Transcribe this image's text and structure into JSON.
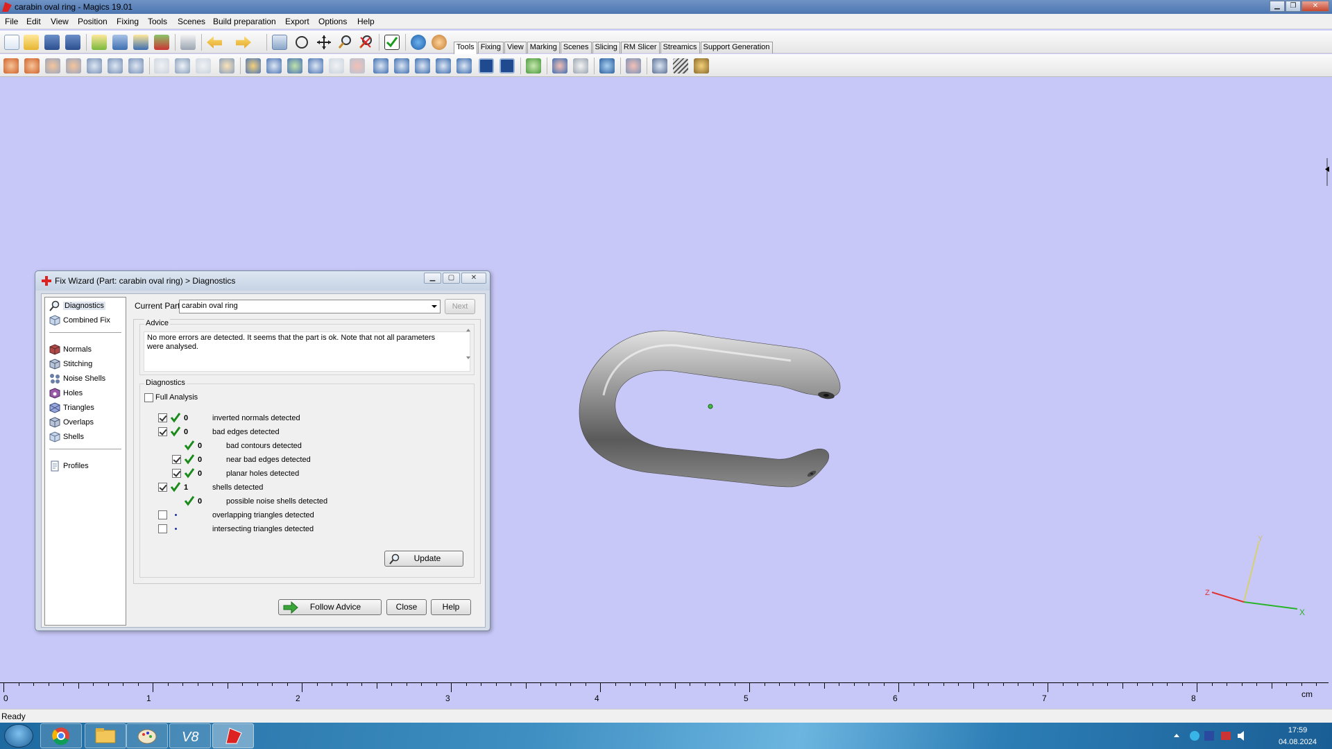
{
  "window": {
    "title": "carabin oval ring - Magics 19.01"
  },
  "menu": [
    "File",
    "Edit",
    "View",
    "Position",
    "Fixing",
    "Tools",
    "Scenes",
    "Build preparation",
    "Export",
    "Options",
    "Help"
  ],
  "tabs": [
    "Tools",
    "Fixing",
    "View",
    "Marking",
    "Scenes",
    "Slicing",
    "RM Slicer",
    "Streamics",
    "Support Generation"
  ],
  "active_tab": "Tools",
  "dialog": {
    "title": "Fix Wizard (Part: carabin oval ring) > Diagnostics",
    "nav_top": [
      "Diagnostics",
      "Combined Fix"
    ],
    "nav_mid": [
      "Normals",
      "Stitching",
      "Noise Shells",
      "Holes",
      "Triangles",
      "Overlaps",
      "Shells"
    ],
    "nav_bottom": [
      "Profiles"
    ],
    "current_part_label": "Current Part:",
    "current_part_value": "carabin oval ring",
    "next_label": "Next",
    "advice_legend": "Advice",
    "advice_text": "No more errors are detected. It seems that the part is ok. Note that not all parameters were analysed.",
    "diagnostics_legend": "Diagnostics",
    "full_analysis_label": "Full Analysis",
    "rows": [
      {
        "count": "0",
        "label": "inverted normals detected"
      },
      {
        "count": "0",
        "label": "bad edges detected"
      },
      {
        "count": "0",
        "label": "bad contours detected"
      },
      {
        "count": "0",
        "label": "near bad edges detected"
      },
      {
        "count": "0",
        "label": "planar holes detected"
      },
      {
        "count": "1",
        "label": "shells detected"
      },
      {
        "count": "0",
        "label": "possible noise shells detected"
      },
      {
        "count": "",
        "label": "overlapping triangles detected"
      },
      {
        "count": "",
        "label": "intersecting triangles detected"
      }
    ],
    "update_label": "Update",
    "follow_advice_label": "Follow Advice",
    "close_label": "Close",
    "help_label": "Help"
  },
  "viewport": {
    "background": "#c8c8f8",
    "axes": {
      "x": "X",
      "y": "Y",
      "z": "Z"
    }
  },
  "ruler": {
    "labels": [
      "0",
      "1",
      "2",
      "3",
      "4",
      "5",
      "6",
      "7",
      "8"
    ],
    "unit": "cm"
  },
  "status": {
    "text": "Ready"
  },
  "taskbar": {
    "time": "17:59",
    "date": "04.08.2024"
  }
}
